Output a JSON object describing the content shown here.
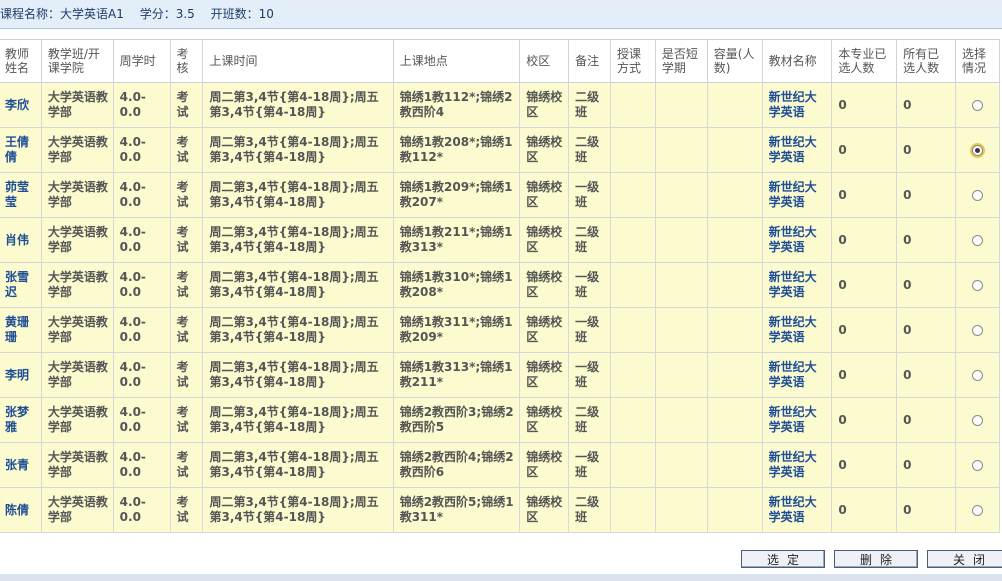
{
  "info": {
    "course_name": "课程名称：大学英语A1",
    "credits": "学分：3.5",
    "class_count": "开班数：10"
  },
  "table": {
    "headers": [
      "教师姓名",
      "教学班/开课学院",
      "周学时",
      "考核",
      "上课时间",
      "上课地点",
      "校区",
      "备注",
      "授课方式",
      "是否短学期",
      "容量(人数)",
      "教材名称",
      "本专业已选人数",
      "所有已选人数",
      "选择情况"
    ],
    "rows": [
      {
        "teacher": "李欣",
        "college": "大学英语教学部",
        "hours": "4.0-0.0",
        "exam": "考试",
        "time": "周二第3,4节{第4-18周};周五第3,4节{第4-18周}",
        "location": "锦绣1教112*;锦绣2教西阶4",
        "campus": "锦绣校区",
        "note": "二级班",
        "mode": "",
        "short_term": "",
        "capacity": "",
        "textbook": "新世纪大学英语",
        "major_selected": "0",
        "all_selected": "0",
        "selected": false
      },
      {
        "teacher": "王倩倩",
        "college": "大学英语教学部",
        "hours": "4.0-0.0",
        "exam": "考试",
        "time": "周二第3,4节{第4-18周};周五第3,4节{第4-18周}",
        "location": "锦绣1教208*;锦绣1教112*",
        "campus": "锦绣校区",
        "note": "二级班",
        "mode": "",
        "short_term": "",
        "capacity": "",
        "textbook": "新世纪大学英语",
        "major_selected": "0",
        "all_selected": "0",
        "selected": true
      },
      {
        "teacher": "茆莹莹",
        "college": "大学英语教学部",
        "hours": "4.0-0.0",
        "exam": "考试",
        "time": "周二第3,4节{第4-18周};周五第3,4节{第4-18周}",
        "location": "锦绣1教209*;锦绣1教207*",
        "campus": "锦绣校区",
        "note": "一级班",
        "mode": "",
        "short_term": "",
        "capacity": "",
        "textbook": "新世纪大学英语",
        "major_selected": "0",
        "all_selected": "0",
        "selected": false
      },
      {
        "teacher": "肖伟",
        "college": "大学英语教学部",
        "hours": "4.0-0.0",
        "exam": "考试",
        "time": "周二第3,4节{第4-18周};周五第3,4节{第4-18周}",
        "location": "锦绣1教211*;锦绣1教313*",
        "campus": "锦绣校区",
        "note": "二级班",
        "mode": "",
        "short_term": "",
        "capacity": "",
        "textbook": "新世纪大学英语",
        "major_selected": "0",
        "all_selected": "0",
        "selected": false
      },
      {
        "teacher": "张雪迟",
        "college": "大学英语教学部",
        "hours": "4.0-0.0",
        "exam": "考试",
        "time": "周二第3,4节{第4-18周};周五第3,4节{第4-18周}",
        "location": "锦绣1教310*;锦绣1教208*",
        "campus": "锦绣校区",
        "note": "一级班",
        "mode": "",
        "short_term": "",
        "capacity": "",
        "textbook": "新世纪大学英语",
        "major_selected": "0",
        "all_selected": "0",
        "selected": false
      },
      {
        "teacher": "黄珊珊",
        "college": "大学英语教学部",
        "hours": "4.0-0.0",
        "exam": "考试",
        "time": "周二第3,4节{第4-18周};周五第3,4节{第4-18周}",
        "location": "锦绣1教311*;锦绣1教209*",
        "campus": "锦绣校区",
        "note": "一级班",
        "mode": "",
        "short_term": "",
        "capacity": "",
        "textbook": "新世纪大学英语",
        "major_selected": "0",
        "all_selected": "0",
        "selected": false
      },
      {
        "teacher": "李明",
        "college": "大学英语教学部",
        "hours": "4.0-0.0",
        "exam": "考试",
        "time": "周二第3,4节{第4-18周};周五第3,4节{第4-18周}",
        "location": "锦绣1教313*;锦绣1教211*",
        "campus": "锦绣校区",
        "note": "一级班",
        "mode": "",
        "short_term": "",
        "capacity": "",
        "textbook": "新世纪大学英语",
        "major_selected": "0",
        "all_selected": "0",
        "selected": false
      },
      {
        "teacher": "张梦雅",
        "college": "大学英语教学部",
        "hours": "4.0-0.0",
        "exam": "考试",
        "time": "周二第3,4节{第4-18周};周五第3,4节{第4-18周}",
        "location": "锦绣2教西阶3;锦绣2教西阶5",
        "campus": "锦绣校区",
        "note": "二级班",
        "mode": "",
        "short_term": "",
        "capacity": "",
        "textbook": "新世纪大学英语",
        "major_selected": "0",
        "all_selected": "0",
        "selected": false
      },
      {
        "teacher": "张青",
        "college": "大学英语教学部",
        "hours": "4.0-0.0",
        "exam": "考试",
        "time": "周二第3,4节{第4-18周};周五第3,4节{第4-18周}",
        "location": "锦绣2教西阶4;锦绣2教西阶6",
        "campus": "锦绣校区",
        "note": "一级班",
        "mode": "",
        "short_term": "",
        "capacity": "",
        "textbook": "新世纪大学英语",
        "major_selected": "0",
        "all_selected": "0",
        "selected": false
      },
      {
        "teacher": "陈倩",
        "college": "大学英语教学部",
        "hours": "4.0-0.0",
        "exam": "考试",
        "time": "周二第3,4节{第4-18周};周五第3,4节{第4-18周}",
        "location": "锦绣2教西阶5;锦绣1教311*",
        "campus": "锦绣校区",
        "note": "二级班",
        "mode": "",
        "short_term": "",
        "capacity": "",
        "textbook": "新世纪大学英语",
        "major_selected": "0",
        "all_selected": "0",
        "selected": false
      }
    ]
  },
  "buttons": {
    "confirm": "选定",
    "delete": "删除",
    "close": "关闭"
  }
}
